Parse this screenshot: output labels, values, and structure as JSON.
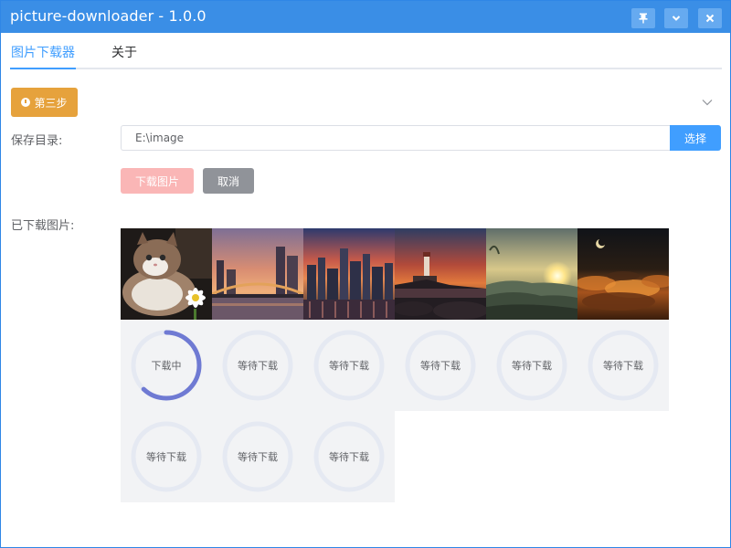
{
  "window": {
    "title": "picture-downloader - 1.0.0"
  },
  "titlebar_buttons": [
    {
      "icon": "pin-icon"
    },
    {
      "icon": "chevron-down-icon"
    },
    {
      "icon": "close-icon"
    }
  ],
  "tabs": [
    {
      "label": "图片下载器",
      "active": true
    },
    {
      "label": "关于",
      "active": false
    }
  ],
  "step": {
    "label": "第三步"
  },
  "form": {
    "save_dir_label": "保存目录:",
    "save_dir_value": "E:\\image",
    "choose_label": "选择",
    "download_label": "下载图片",
    "cancel_label": "取消",
    "downloaded_label": "已下载图片:"
  },
  "images": [
    {
      "subject": "cat with daisy"
    },
    {
      "subject": "city bridge at sunset"
    },
    {
      "subject": "city skyline at dusk"
    },
    {
      "subject": "lighthouse at sunset"
    },
    {
      "subject": "sunrise over hills"
    },
    {
      "subject": "night clouds with moon"
    }
  ],
  "progress": [
    {
      "status": "下载中",
      "percent": 62
    },
    {
      "status": "等待下载",
      "percent": 0
    },
    {
      "status": "等待下载",
      "percent": 0
    },
    {
      "status": "等待下载",
      "percent": 0
    },
    {
      "status": "等待下载",
      "percent": 0
    },
    {
      "status": "等待下载",
      "percent": 0
    },
    {
      "status": "等待下载",
      "percent": 0
    },
    {
      "status": "等待下载",
      "percent": 0
    },
    {
      "status": "等待下载",
      "percent": 0
    }
  ],
  "colors": {
    "primary": "#409eff",
    "titlebar": "#3a8ee6",
    "warning": "#e6a23c",
    "danger_light": "#fab6b6",
    "info": "#909399",
    "progress_active": "#6f7ad3",
    "progress_track": "#e5e9f2"
  }
}
